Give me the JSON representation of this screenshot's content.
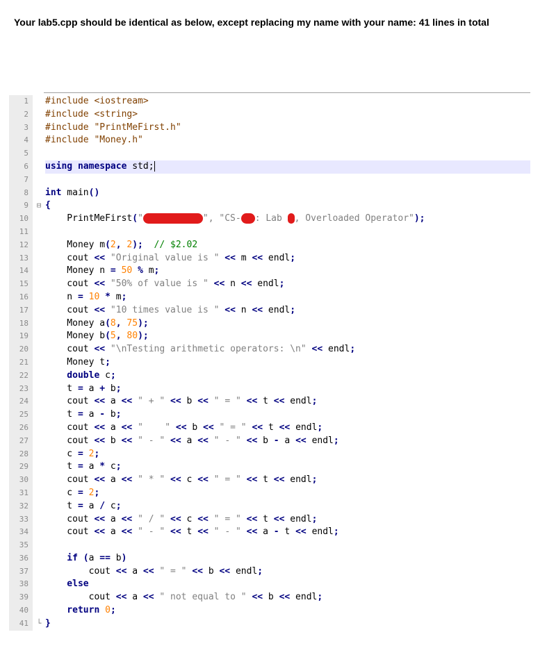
{
  "header": "Your lab5.cpp should be identical as below, except replacing my name with your name: 41 lines in total",
  "line_numbers": [
    "1",
    "2",
    "3",
    "4",
    "5",
    "6",
    "7",
    "8",
    "9",
    "10",
    "11",
    "12",
    "13",
    "14",
    "15",
    "16",
    "17",
    "18",
    "19",
    "20",
    "21",
    "22",
    "23",
    "24",
    "25",
    "26",
    "27",
    "28",
    "29",
    "30",
    "31",
    "32",
    "33",
    "34",
    "35",
    "36",
    "37",
    "38",
    "39",
    "40",
    "41"
  ],
  "fold_markers": {
    "9": "⊟",
    "41": "└"
  },
  "current_line": 6,
  "colors": {
    "keyword": "#000080",
    "preprocessor": "#804000",
    "string": "#808080",
    "number": "#ff8000",
    "comment": "#008000",
    "redaction": "#e11b1b"
  },
  "lines": [
    [
      [
        "pp",
        "#include <iostream>"
      ]
    ],
    [
      [
        "pp",
        "#include <string>"
      ]
    ],
    [
      [
        "pp",
        "#include \"PrintMeFirst.h\""
      ]
    ],
    [
      [
        "pp",
        "#include \"Money.h\""
      ]
    ],
    [],
    [
      [
        "kw",
        "using namespace"
      ],
      [
        "t",
        " std;"
      ],
      [
        "caret",
        ""
      ]
    ],
    [],
    [
      [
        "kw",
        "int"
      ],
      [
        "t",
        " main"
      ],
      [
        "op",
        "()"
      ]
    ],
    [
      [
        "op",
        "{"
      ]
    ],
    [
      [
        "t",
        "    PrintMeFirst"
      ],
      [
        "op",
        "("
      ],
      [
        "str",
        "\""
      ],
      [
        "redact",
        "86"
      ],
      [
        "str",
        "\", \"CS-"
      ],
      [
        "redact",
        "20"
      ],
      [
        "str",
        ": Lab "
      ],
      [
        "redact",
        "10"
      ],
      [
        "str",
        ", Overloaded Operator\""
      ],
      [
        "op",
        ");"
      ]
    ],
    [],
    [
      [
        "t",
        "    Money m"
      ],
      [
        "op",
        "("
      ],
      [
        "num",
        "2"
      ],
      [
        "op",
        ", "
      ],
      [
        "num",
        "2"
      ],
      [
        "op",
        ");"
      ],
      [
        "t",
        "  "
      ],
      [
        "cm",
        "// $2.02"
      ]
    ],
    [
      [
        "t",
        "    cout "
      ],
      [
        "op",
        "<<"
      ],
      [
        "str",
        " \"Original value is \" "
      ],
      [
        "op",
        "<<"
      ],
      [
        "t",
        " m "
      ],
      [
        "op",
        "<<"
      ],
      [
        "t",
        " endl"
      ],
      [
        "op",
        ";"
      ]
    ],
    [
      [
        "t",
        "    Money n "
      ],
      [
        "op",
        "="
      ],
      [
        "t",
        " "
      ],
      [
        "num",
        "50"
      ],
      [
        "t",
        " "
      ],
      [
        "op",
        "%"
      ],
      [
        "t",
        " m"
      ],
      [
        "op",
        ";"
      ]
    ],
    [
      [
        "t",
        "    cout "
      ],
      [
        "op",
        "<<"
      ],
      [
        "str",
        " \"50% of value is \" "
      ],
      [
        "op",
        "<<"
      ],
      [
        "t",
        " n "
      ],
      [
        "op",
        "<<"
      ],
      [
        "t",
        " endl"
      ],
      [
        "op",
        ";"
      ]
    ],
    [
      [
        "t",
        "    n "
      ],
      [
        "op",
        "="
      ],
      [
        "t",
        " "
      ],
      [
        "num",
        "10"
      ],
      [
        "t",
        " "
      ],
      [
        "op",
        "*"
      ],
      [
        "t",
        " m"
      ],
      [
        "op",
        ";"
      ]
    ],
    [
      [
        "t",
        "    cout "
      ],
      [
        "op",
        "<<"
      ],
      [
        "str",
        " \"10 times value is \" "
      ],
      [
        "op",
        "<<"
      ],
      [
        "t",
        " n "
      ],
      [
        "op",
        "<<"
      ],
      [
        "t",
        " endl"
      ],
      [
        "op",
        ";"
      ]
    ],
    [
      [
        "t",
        "    Money a"
      ],
      [
        "op",
        "("
      ],
      [
        "num",
        "8"
      ],
      [
        "op",
        ", "
      ],
      [
        "num",
        "75"
      ],
      [
        "op",
        ");"
      ]
    ],
    [
      [
        "t",
        "    Money b"
      ],
      [
        "op",
        "("
      ],
      [
        "num",
        "5"
      ],
      [
        "op",
        ", "
      ],
      [
        "num",
        "80"
      ],
      [
        "op",
        ");"
      ]
    ],
    [
      [
        "t",
        "    cout "
      ],
      [
        "op",
        "<<"
      ],
      [
        "str",
        " \"\\nTesting arithmetic operators: \\n\" "
      ],
      [
        "op",
        "<<"
      ],
      [
        "t",
        " endl"
      ],
      [
        "op",
        ";"
      ]
    ],
    [
      [
        "t",
        "    Money t"
      ],
      [
        "op",
        ";"
      ]
    ],
    [
      [
        "kw",
        "    double"
      ],
      [
        "t",
        " c"
      ],
      [
        "op",
        ";"
      ]
    ],
    [
      [
        "t",
        "    t "
      ],
      [
        "op",
        "="
      ],
      [
        "t",
        " a "
      ],
      [
        "op",
        "+"
      ],
      [
        "t",
        " b"
      ],
      [
        "op",
        ";"
      ]
    ],
    [
      [
        "t",
        "    cout "
      ],
      [
        "op",
        "<<"
      ],
      [
        "t",
        " a "
      ],
      [
        "op",
        "<<"
      ],
      [
        "str",
        " \" + \" "
      ],
      [
        "op",
        "<<"
      ],
      [
        "t",
        " b "
      ],
      [
        "op",
        "<<"
      ],
      [
        "str",
        " \" = \" "
      ],
      [
        "op",
        "<<"
      ],
      [
        "t",
        " t "
      ],
      [
        "op",
        "<<"
      ],
      [
        "t",
        " endl"
      ],
      [
        "op",
        ";"
      ]
    ],
    [
      [
        "t",
        "    t "
      ],
      [
        "op",
        "="
      ],
      [
        "t",
        " a "
      ],
      [
        "op",
        "-"
      ],
      [
        "t",
        " b"
      ],
      [
        "op",
        ";"
      ]
    ],
    [
      [
        "t",
        "    cout "
      ],
      [
        "op",
        "<<"
      ],
      [
        "t",
        " a "
      ],
      [
        "op",
        "<<"
      ],
      [
        "str",
        " \"    \" "
      ],
      [
        "op",
        "<<"
      ],
      [
        "t",
        " b "
      ],
      [
        "op",
        "<<"
      ],
      [
        "str",
        " \" = \" "
      ],
      [
        "op",
        "<<"
      ],
      [
        "t",
        " t "
      ],
      [
        "op",
        "<<"
      ],
      [
        "t",
        " endl"
      ],
      [
        "op",
        ";"
      ]
    ],
    [
      [
        "t",
        "    cout "
      ],
      [
        "op",
        "<<"
      ],
      [
        "t",
        " b "
      ],
      [
        "op",
        "<<"
      ],
      [
        "str",
        " \" - \" "
      ],
      [
        "op",
        "<<"
      ],
      [
        "t",
        " a "
      ],
      [
        "op",
        "<<"
      ],
      [
        "str",
        " \" - \" "
      ],
      [
        "op",
        "<<"
      ],
      [
        "t",
        " b "
      ],
      [
        "op",
        "-"
      ],
      [
        "t",
        " a "
      ],
      [
        "op",
        "<<"
      ],
      [
        "t",
        " endl"
      ],
      [
        "op",
        ";"
      ]
    ],
    [
      [
        "t",
        "    c "
      ],
      [
        "op",
        "="
      ],
      [
        "t",
        " "
      ],
      [
        "num",
        "2"
      ],
      [
        "op",
        ";"
      ]
    ],
    [
      [
        "t",
        "    t "
      ],
      [
        "op",
        "="
      ],
      [
        "t",
        " a "
      ],
      [
        "op",
        "*"
      ],
      [
        "t",
        " c"
      ],
      [
        "op",
        ";"
      ]
    ],
    [
      [
        "t",
        "    cout "
      ],
      [
        "op",
        "<<"
      ],
      [
        "t",
        " a "
      ],
      [
        "op",
        "<<"
      ],
      [
        "str",
        " \" * \" "
      ],
      [
        "op",
        "<<"
      ],
      [
        "t",
        " c "
      ],
      [
        "op",
        "<<"
      ],
      [
        "str",
        " \" = \" "
      ],
      [
        "op",
        "<<"
      ],
      [
        "t",
        " t "
      ],
      [
        "op",
        "<<"
      ],
      [
        "t",
        " endl"
      ],
      [
        "op",
        ";"
      ]
    ],
    [
      [
        "t",
        "    c "
      ],
      [
        "op",
        "="
      ],
      [
        "t",
        " "
      ],
      [
        "num",
        "2"
      ],
      [
        "op",
        ";"
      ]
    ],
    [
      [
        "t",
        "    t "
      ],
      [
        "op",
        "="
      ],
      [
        "t",
        " a "
      ],
      [
        "op",
        "/"
      ],
      [
        "t",
        " c"
      ],
      [
        "op",
        ";"
      ]
    ],
    [
      [
        "t",
        "    cout "
      ],
      [
        "op",
        "<<"
      ],
      [
        "t",
        " a "
      ],
      [
        "op",
        "<<"
      ],
      [
        "str",
        " \" / \" "
      ],
      [
        "op",
        "<<"
      ],
      [
        "t",
        " c "
      ],
      [
        "op",
        "<<"
      ],
      [
        "str",
        " \" = \" "
      ],
      [
        "op",
        "<<"
      ],
      [
        "t",
        " t "
      ],
      [
        "op",
        "<<"
      ],
      [
        "t",
        " endl"
      ],
      [
        "op",
        ";"
      ]
    ],
    [
      [
        "t",
        "    cout "
      ],
      [
        "op",
        "<<"
      ],
      [
        "t",
        " a "
      ],
      [
        "op",
        "<<"
      ],
      [
        "str",
        " \" - \" "
      ],
      [
        "op",
        "<<"
      ],
      [
        "t",
        " t "
      ],
      [
        "op",
        "<<"
      ],
      [
        "str",
        " \" - \" "
      ],
      [
        "op",
        "<<"
      ],
      [
        "t",
        " a "
      ],
      [
        "op",
        "-"
      ],
      [
        "t",
        " t "
      ],
      [
        "op",
        "<<"
      ],
      [
        "t",
        " endl"
      ],
      [
        "op",
        ";"
      ]
    ],
    [],
    [
      [
        "kw",
        "    if"
      ],
      [
        "t",
        " "
      ],
      [
        "op",
        "("
      ],
      [
        "t",
        "a "
      ],
      [
        "op",
        "=="
      ],
      [
        "t",
        " b"
      ],
      [
        "op",
        ")"
      ]
    ],
    [
      [
        "t",
        "        cout "
      ],
      [
        "op",
        "<<"
      ],
      [
        "t",
        " a "
      ],
      [
        "op",
        "<<"
      ],
      [
        "str",
        " \" = \" "
      ],
      [
        "op",
        "<<"
      ],
      [
        "t",
        " b "
      ],
      [
        "op",
        "<<"
      ],
      [
        "t",
        " endl"
      ],
      [
        "op",
        ";"
      ]
    ],
    [
      [
        "kw",
        "    else"
      ]
    ],
    [
      [
        "t",
        "        cout "
      ],
      [
        "op",
        "<<"
      ],
      [
        "t",
        " a "
      ],
      [
        "op",
        "<<"
      ],
      [
        "str",
        " \" not equal to \" "
      ],
      [
        "op",
        "<<"
      ],
      [
        "t",
        " b "
      ],
      [
        "op",
        "<<"
      ],
      [
        "t",
        " endl"
      ],
      [
        "op",
        ";"
      ]
    ],
    [
      [
        "kw",
        "    return"
      ],
      [
        "t",
        " "
      ],
      [
        "num",
        "0"
      ],
      [
        "op",
        ";"
      ]
    ],
    [
      [
        "op",
        "}"
      ]
    ]
  ]
}
